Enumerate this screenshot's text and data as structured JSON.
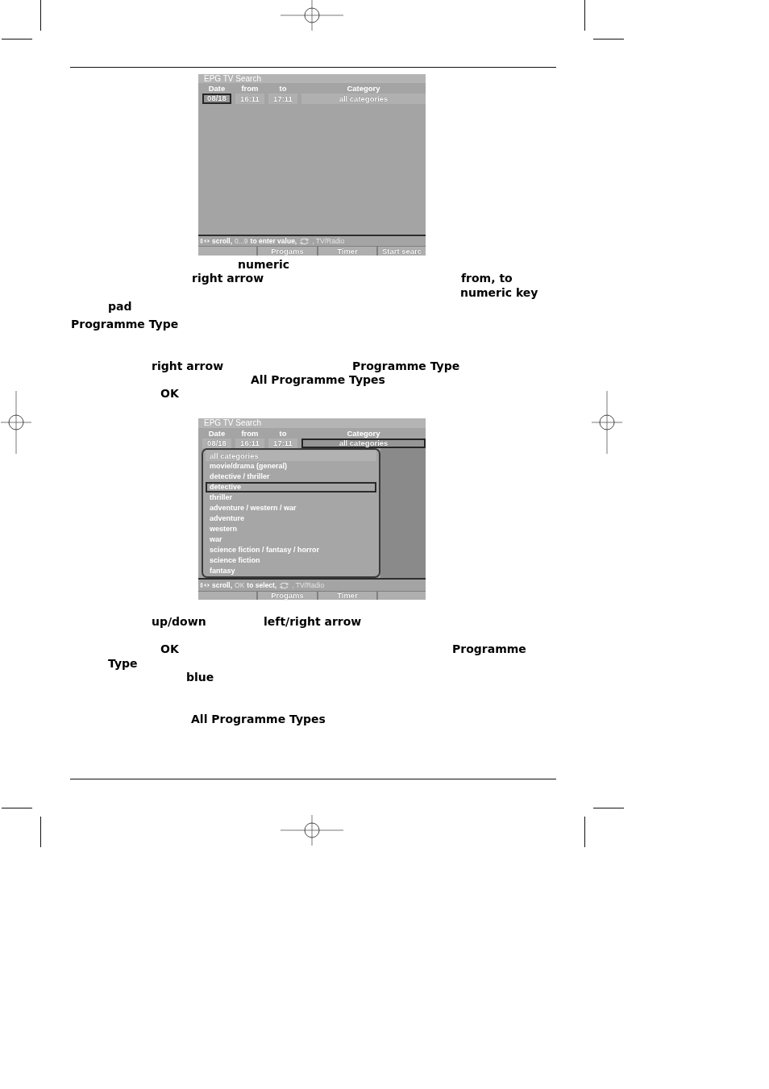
{
  "screenshot_1": {
    "title": "EPG TV Search",
    "columns": [
      "Date",
      "from",
      "to",
      "Category"
    ],
    "fields": [
      {
        "value": "08/18",
        "selected": true
      },
      {
        "value": "16:11",
        "selected": false
      },
      {
        "value": "17:11",
        "selected": false
      },
      {
        "value": "all categories",
        "selected": false
      }
    ],
    "help_bar": [
      {
        "kind": "action",
        "text": "scroll,"
      },
      {
        "kind": "key",
        "text": "0...9"
      },
      {
        "kind": "action",
        "text": "to enter value,"
      },
      {
        "kind": "key",
        "text": ", TV/Radio"
      }
    ],
    "buttons": [
      {
        "kind": "blank"
      },
      {
        "kind": "labeled",
        "label": "Progams"
      },
      {
        "kind": "labeled",
        "label": "Timer"
      },
      {
        "kind": "labeled",
        "label": "Start searc"
      }
    ]
  },
  "instructions_1": {
    "lines": [
      [
        "numeric"
      ],
      [
        "right arrow",
        "from, to"
      ],
      [
        "numeric key"
      ],
      [
        "pad"
      ],
      [
        "Programme Type"
      ]
    ]
  },
  "instructions_2": {
    "lines": [
      [
        "right arrow",
        "Programme Type"
      ],
      [
        "All Programme Types"
      ],
      [
        "OK"
      ]
    ]
  },
  "screenshot_2": {
    "title": "EPG TV Search",
    "columns": [
      "Date",
      "from",
      "to",
      "Category"
    ],
    "fields": [
      {
        "value": "08/18",
        "selected": false
      },
      {
        "value": "16:11",
        "selected": false
      },
      {
        "value": "17:11",
        "selected": false
      },
      {
        "value": "all categories",
        "selected": true
      }
    ],
    "category_list": [
      {
        "label": "all categories",
        "selected": true,
        "focused": false
      },
      {
        "label": "movie/drama (general)",
        "selected": false,
        "focused": false
      },
      {
        "label": "detective / thriller",
        "selected": false,
        "focused": false
      },
      {
        "label": "detective",
        "selected": false,
        "focused": true
      },
      {
        "label": "thriller",
        "selected": false,
        "focused": false
      },
      {
        "label": "adventure / western / war",
        "selected": false,
        "focused": false
      },
      {
        "label": "adventure",
        "selected": false,
        "focused": false
      },
      {
        "label": "western",
        "selected": false,
        "focused": false
      },
      {
        "label": "war",
        "selected": false,
        "focused": false
      },
      {
        "label": "science fiction / fantasy / horror",
        "selected": false,
        "focused": false
      },
      {
        "label": "science fiction",
        "selected": false,
        "focused": false
      },
      {
        "label": "fantasy",
        "selected": false,
        "focused": false
      }
    ],
    "help_bar": [
      {
        "kind": "action",
        "text": "scroll,"
      },
      {
        "kind": "key",
        "text": "OK"
      },
      {
        "kind": "action",
        "text": "to select,"
      },
      {
        "kind": "key",
        "text": ", TV/Radio"
      }
    ],
    "buttons": [
      {
        "kind": "blank"
      },
      {
        "kind": "labeled",
        "label": "Progams"
      },
      {
        "kind": "labeled",
        "label": "Timer"
      },
      {
        "kind": "blank"
      }
    ]
  },
  "instructions_3": {
    "lines": [
      [
        "up/down",
        "left/right arrow"
      ],
      [
        "OK",
        "Programme"
      ],
      [
        "Type"
      ],
      [
        "blue"
      ],
      [
        "All Programme Types"
      ]
    ]
  }
}
